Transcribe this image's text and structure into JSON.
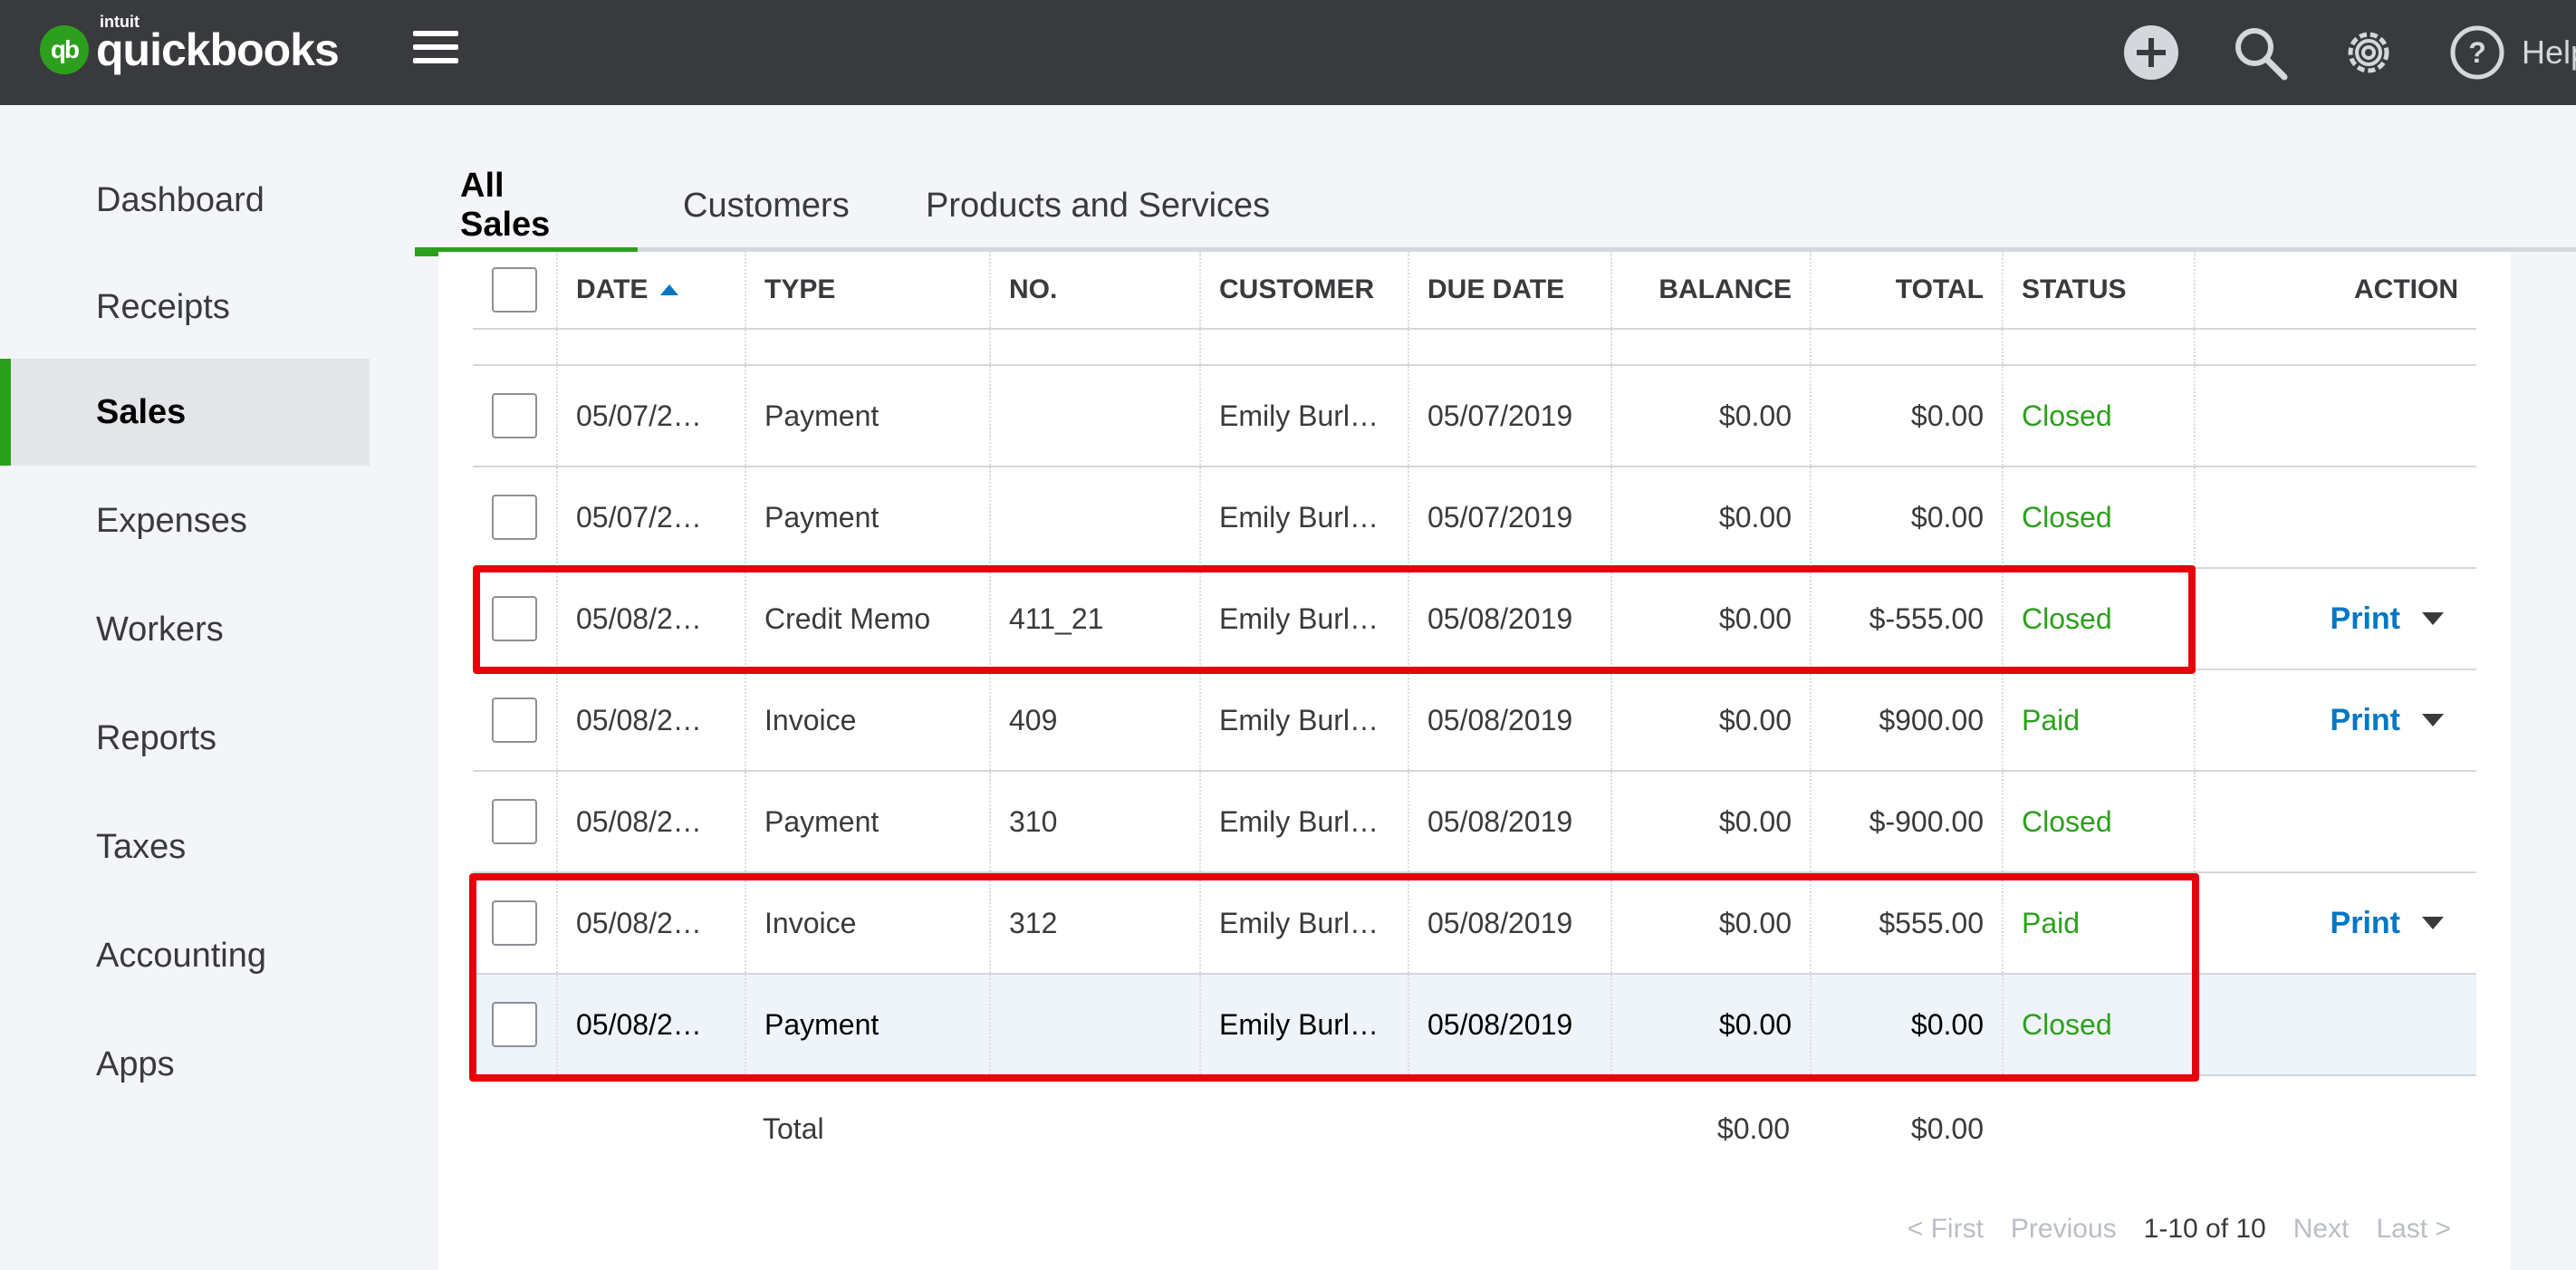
{
  "topbar": {
    "logo_small": "intuit",
    "logo_word": "quickbooks",
    "logo_mark": "qb",
    "help_label": "Help",
    "icons": [
      "plus-icon",
      "search-icon",
      "gear-icon",
      "help-icon"
    ]
  },
  "sidebar": {
    "items": [
      {
        "label": "Dashboard"
      },
      {
        "label": "Receipts"
      },
      {
        "label": "Sales"
      },
      {
        "label": "Expenses"
      },
      {
        "label": "Workers"
      },
      {
        "label": "Reports"
      },
      {
        "label": "Taxes"
      },
      {
        "label": "Accounting"
      },
      {
        "label": "Apps"
      }
    ],
    "active": "Sales"
  },
  "tabs": [
    {
      "label": "All Sales"
    },
    {
      "label": "Customers"
    },
    {
      "label": "Products and Services"
    }
  ],
  "table": {
    "headers": {
      "date": "DATE",
      "type": "TYPE",
      "no": "NO.",
      "customer": "CUSTOMER",
      "due_date": "DUE DATE",
      "balance": "BALANCE",
      "total": "TOTAL",
      "status": "STATUS",
      "action": "ACTION"
    },
    "rows": [
      {
        "date": "05/07/2…",
        "type": "Payment",
        "no": "",
        "customer": "Emily Burl…",
        "due_date": "05/07/2019",
        "balance": "$0.00",
        "total": "$0.00",
        "status": "Closed",
        "action": ""
      },
      {
        "date": "05/07/2…",
        "type": "Payment",
        "no": "",
        "customer": "Emily Burl…",
        "due_date": "05/07/2019",
        "balance": "$0.00",
        "total": "$0.00",
        "status": "Closed",
        "action": ""
      },
      {
        "date": "05/08/2…",
        "type": "Credit Memo",
        "no": "411_21",
        "customer": "Emily Burl…",
        "due_date": "05/08/2019",
        "balance": "$0.00",
        "total": "$-555.00",
        "status": "Closed",
        "action": "Print"
      },
      {
        "date": "05/08/2…",
        "type": "Invoice",
        "no": "409",
        "customer": "Emily Burl…",
        "due_date": "05/08/2019",
        "balance": "$0.00",
        "total": "$900.00",
        "status": "Paid",
        "action": "Print"
      },
      {
        "date": "05/08/2…",
        "type": "Payment",
        "no": "310",
        "customer": "Emily Burl…",
        "due_date": "05/08/2019",
        "balance": "$0.00",
        "total": "$-900.00",
        "status": "Closed",
        "action": ""
      },
      {
        "date": "05/08/2…",
        "type": "Invoice",
        "no": "312",
        "customer": "Emily Burl…",
        "due_date": "05/08/2019",
        "balance": "$0.00",
        "total": "$555.00",
        "status": "Paid",
        "action": "Print"
      },
      {
        "date": "05/08/2…",
        "type": "Payment",
        "no": "",
        "customer": "Emily Burl…",
        "due_date": "05/08/2019",
        "balance": "$0.00",
        "total": "$0.00",
        "status": "Closed",
        "action": ""
      }
    ],
    "total_row": {
      "label": "Total",
      "balance": "$0.00",
      "total": "$0.00"
    }
  },
  "pager": {
    "first": "< First",
    "previous": "Previous",
    "range": "1-10 of 10",
    "next": "Next",
    "last": "Last >"
  },
  "colors": {
    "brand_green": "#2ca01c",
    "link_blue": "#0077c5",
    "annotation_red": "#e8000b",
    "topbar": "#393a3d"
  }
}
